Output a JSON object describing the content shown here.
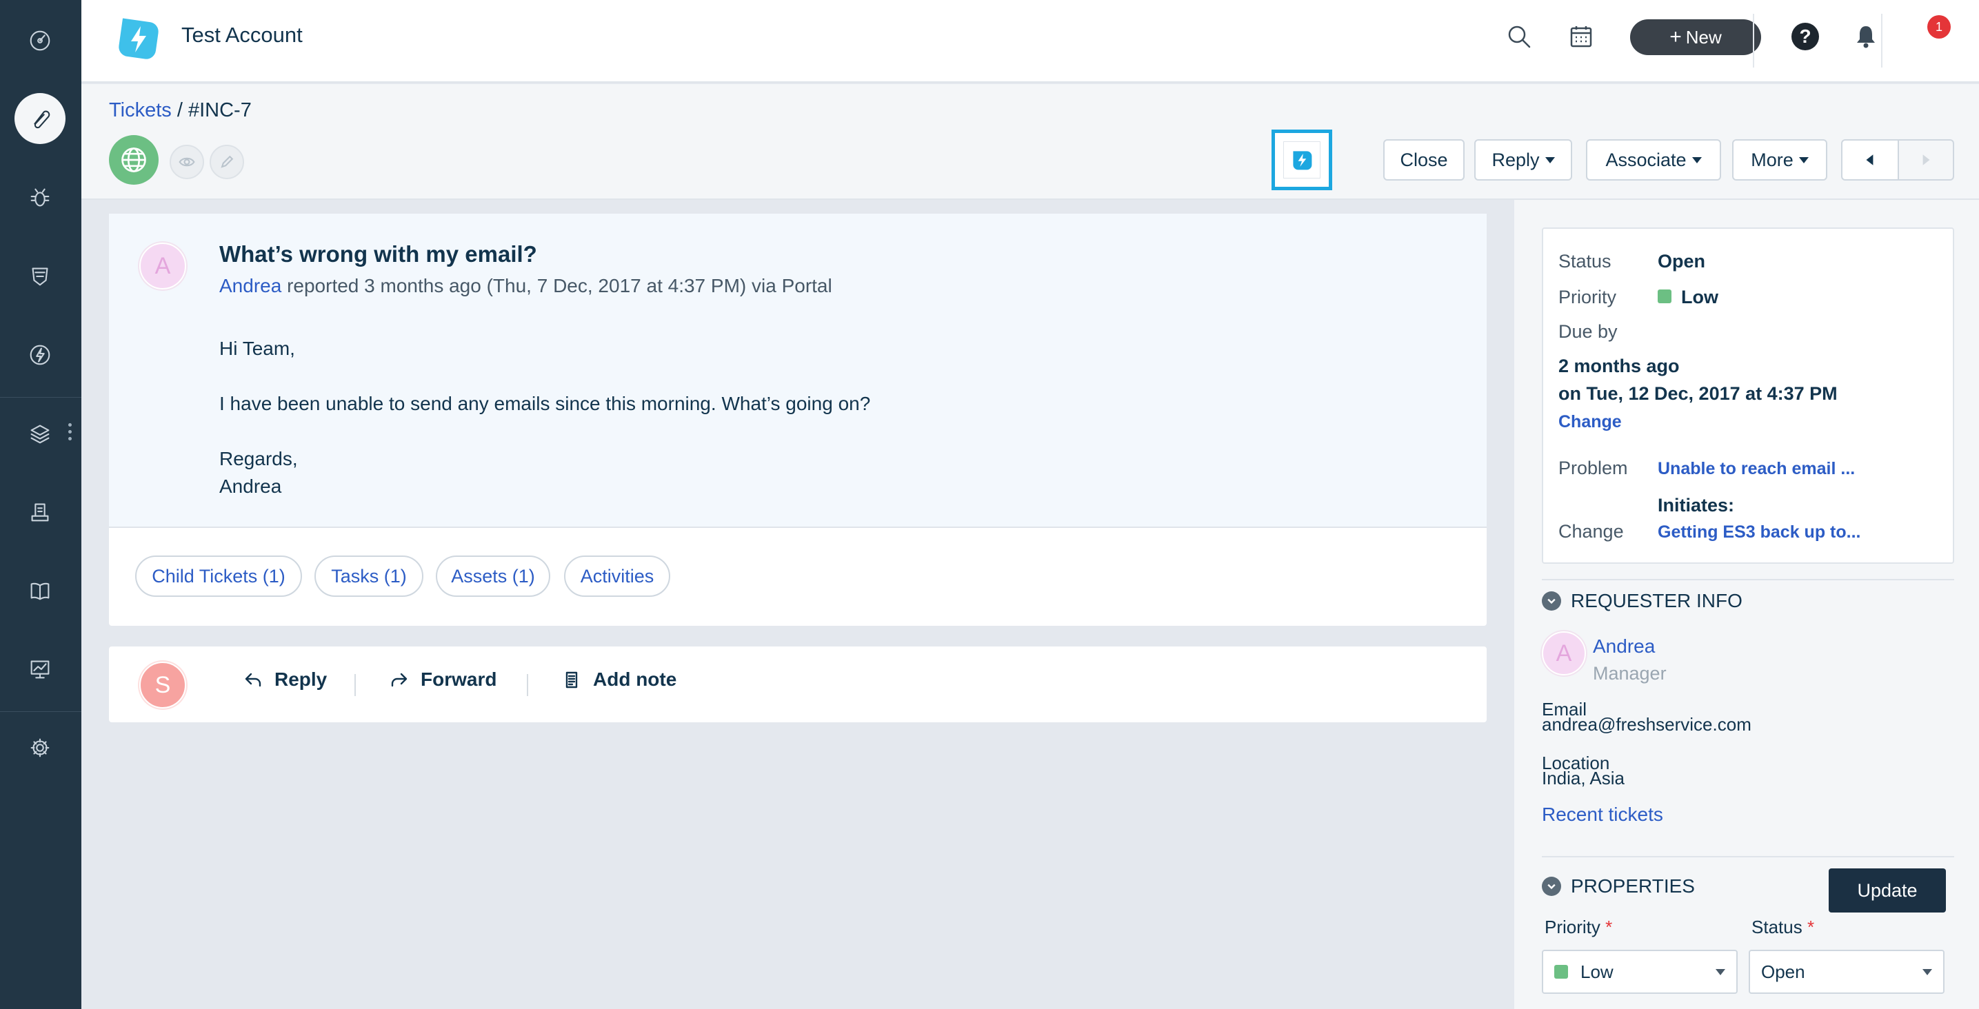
{
  "header": {
    "account_title": "Test Account",
    "new_label": "New",
    "notification_count": "1",
    "user_initial": "S"
  },
  "breadcrumb": {
    "parent": "Tickets",
    "separator": "/",
    "current": "#INC-7"
  },
  "toolbar": {
    "close": "Close",
    "reply": "Reply",
    "associate": "Associate",
    "more": "More"
  },
  "ticket": {
    "requester_initial": "A",
    "title": "What’s wrong with my email?",
    "requester": "Andrea",
    "meta": "reported 3 months ago (Thu, 7 Dec, 2017 at 4:37 PM) via Portal",
    "body": [
      "Hi Team,",
      "I have been unable to send any emails since this morning. What’s going on?",
      "Regards,",
      "Andrea"
    ],
    "tabs": [
      "Child Tickets (1)",
      "Tasks  (1)",
      "Assets (1)",
      "Activities"
    ]
  },
  "reply_bar": {
    "agent_initial": "S",
    "reply": "Reply",
    "forward": "Forward",
    "add_note": "Add note"
  },
  "details": {
    "status_label": "Status",
    "status_value": "Open",
    "priority_label": "Priority",
    "priority_value": "Low",
    "priority_color": "#6cbf83",
    "due_label": "Due by",
    "due_relative": "2 months ago",
    "due_date": "on Tue, 12 Dec, 2017 at 4:37 PM",
    "change_link": "Change",
    "problem_label": "Problem",
    "problem_value": "Unable to reach email ...",
    "initiates_label": "Initiates:",
    "change_label": "Change",
    "change_value": "Getting ES3 back up to..."
  },
  "requester_info": {
    "heading": "REQUESTER INFO",
    "initial": "A",
    "name": "Andrea",
    "role": "Manager",
    "email_label": "Email",
    "email": "andrea@freshservice.com",
    "location_label": "Location",
    "location": "India, Asia",
    "recent_tickets": "Recent tickets"
  },
  "properties": {
    "heading": "PROPERTIES",
    "update": "Update",
    "priority_label": "Priority",
    "priority_value": "Low",
    "status_label": "Status",
    "status_value": "Open",
    "required_mark": "*"
  },
  "colors": {
    "sidebar": "#223645",
    "link": "#2c5cc5",
    "highlight": "#1ca7e0",
    "badge": "#e43538"
  }
}
